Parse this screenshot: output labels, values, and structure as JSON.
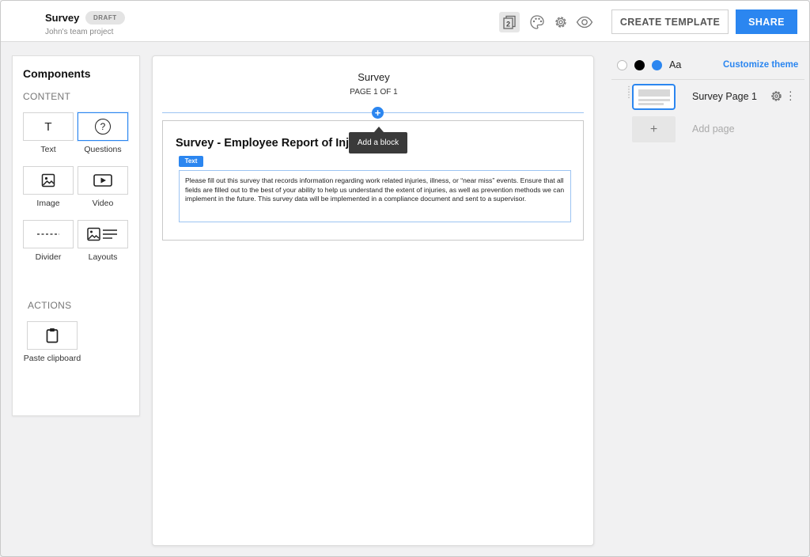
{
  "header": {
    "title": "Survey",
    "badge": "DRAFT",
    "subtitle": "John's team project",
    "pages_icon_label": "2",
    "create_template_label": "CREATE TEMPLATE",
    "share_label": "SHARE",
    "icons": [
      "pages-icon",
      "palette-icon",
      "gear-icon",
      "eye-icon"
    ]
  },
  "components": {
    "title": "Components",
    "content_label": "CONTENT",
    "items": [
      {
        "label": "Text",
        "icon": "text-icon",
        "glyph": "T"
      },
      {
        "label": "Questions",
        "icon": "question-icon",
        "glyph": "?"
      },
      {
        "label": "Image",
        "icon": "image-icon"
      },
      {
        "label": "Video",
        "icon": "video-icon"
      },
      {
        "label": "Divider",
        "icon": "divider-icon"
      },
      {
        "label": "Layouts",
        "icon": "layouts-icon"
      }
    ],
    "actions_label": "ACTIONS",
    "paste_label": "Paste clipboard"
  },
  "canvas": {
    "title": "Survey",
    "page_indicator": "PAGE 1 OF 1",
    "block_title": "Survey - Employee Report of Injury",
    "text_tag": "Text",
    "body_text": "Please fill out this survey that records information regarding work related injuries, illness, or “near miss” events. Ensure that all fields are filled out to the best of your ability to help us understand the extent of injuries, as well as prevention methods we can implement in the future. This survey data will be implemented in a compliance document and sent to a supervisor.",
    "tooltip": "Add a block"
  },
  "theme": {
    "swatches": [
      "#ffffff",
      "#000000",
      "#2b86f0"
    ],
    "font_label": "Aa",
    "customize_label": "Customize theme"
  },
  "pages": {
    "items": [
      {
        "name": "Survey Page 1"
      }
    ],
    "add_label": "Add page"
  },
  "colors": {
    "accent": "#2b86f0",
    "tooltip_bg": "#3a3a3a",
    "background": "#f1f1f2"
  }
}
